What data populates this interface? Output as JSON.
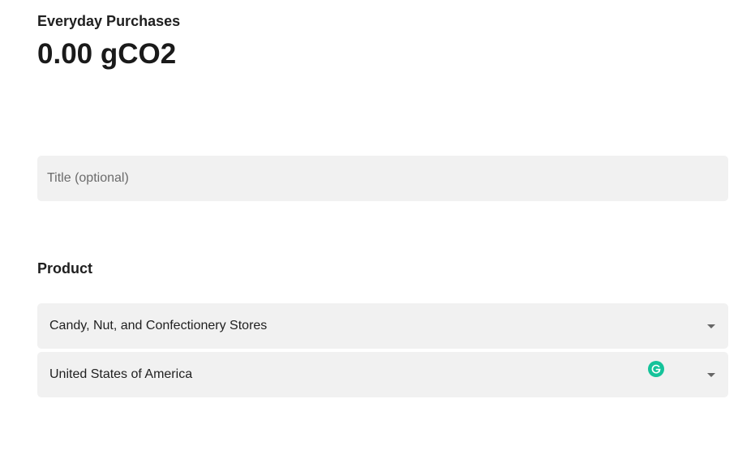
{
  "header": {
    "category": "Everyday Purchases",
    "total": "0.00 gCO2"
  },
  "form": {
    "title_placeholder": "Title (optional)",
    "title_value": "",
    "product_heading": "Product",
    "product_select": {
      "selected": "Candy, Nut, and Confectionery Stores"
    },
    "country_select": {
      "selected": "United States of America"
    }
  },
  "icons": {
    "caret": "chevron-down-icon",
    "assistant": "grammarly-icon"
  },
  "colors": {
    "field_background": "#f1f1f1",
    "text": "#1f1f1f",
    "assistant_icon": "#15c39a"
  }
}
